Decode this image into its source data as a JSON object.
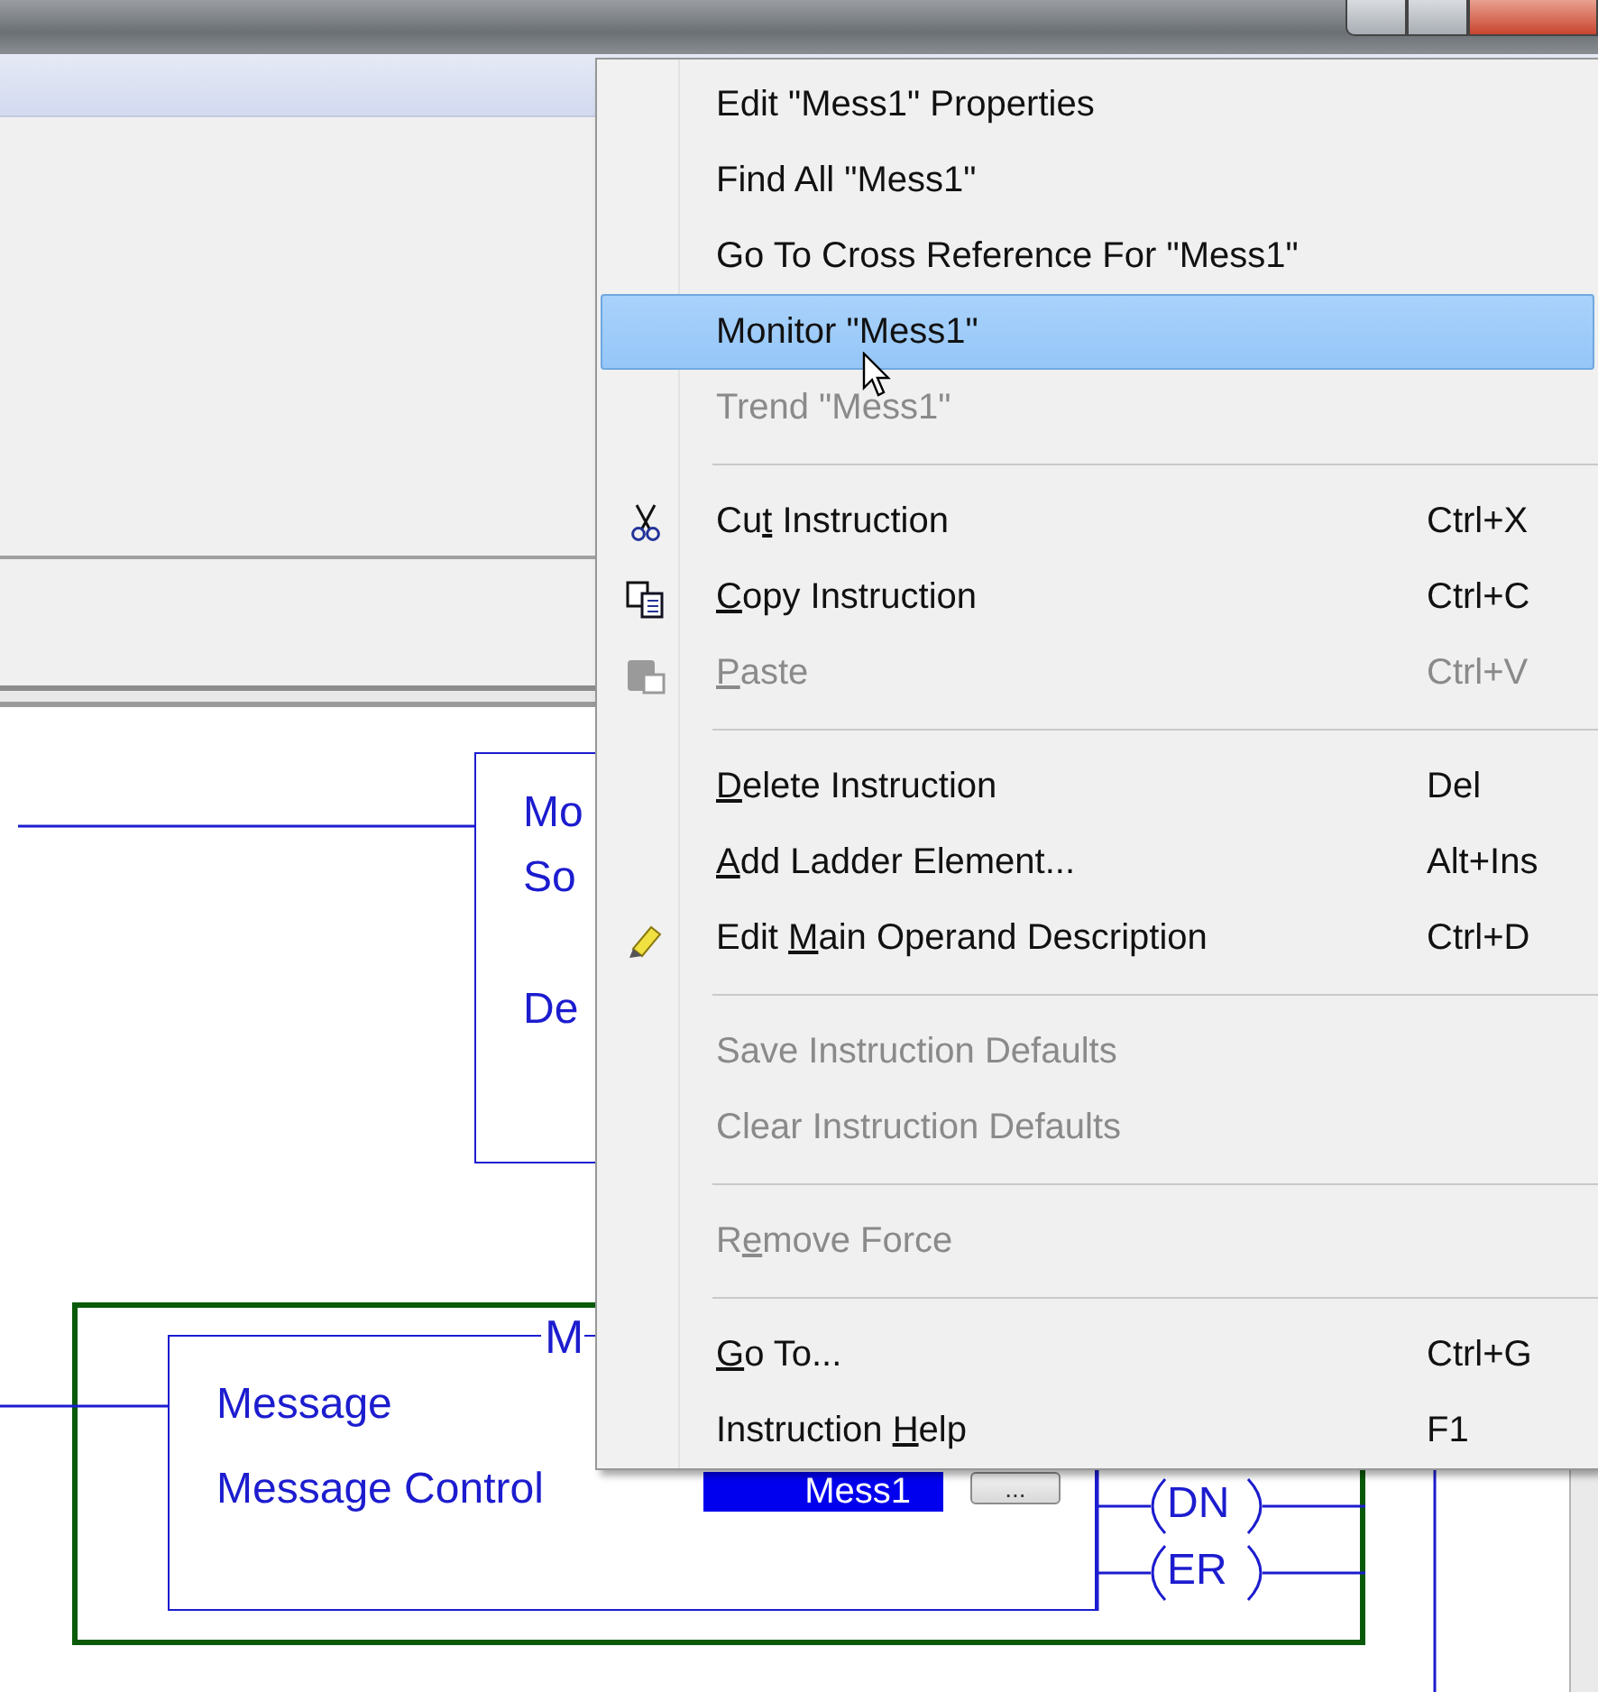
{
  "ladder": {
    "rungs": [
      {
        "kind": "block",
        "selected": false,
        "lines": [
          "Mo",
          "So",
          "De"
        ]
      },
      {
        "kind": "message",
        "selected": true,
        "header": "M",
        "lines": [
          "Message",
          "Message Control"
        ],
        "tag": "Mess1",
        "browse": "...",
        "coils": [
          "DN",
          "ER"
        ]
      }
    ]
  },
  "context_menu": {
    "items": [
      {
        "kind": "item",
        "label": "Edit \"Mess1\" Properties",
        "disabled": false,
        "selected": false
      },
      {
        "kind": "item",
        "label": "Find All \"Mess1\"",
        "disabled": false,
        "selected": false
      },
      {
        "kind": "item",
        "label": "Go To Cross Reference For \"Mess1\"",
        "disabled": false,
        "selected": false
      },
      {
        "kind": "item",
        "label": "Monitor \"Mess1\"",
        "disabled": false,
        "selected": true
      },
      {
        "kind": "item",
        "label": "Trend \"Mess1\"",
        "disabled": true,
        "selected": false
      },
      {
        "kind": "separator"
      },
      {
        "kind": "item",
        "parts": {
          "before": "Cu",
          "key": "t",
          "after": " Instruction"
        },
        "shortcut": "Ctrl+X",
        "disabled": false,
        "selected": false
      },
      {
        "kind": "item",
        "parts": {
          "key": "C",
          "after": "opy Instruction"
        },
        "shortcut": "Ctrl+C",
        "disabled": false,
        "selected": false
      },
      {
        "kind": "item",
        "parts": {
          "key": "P",
          "after": "aste"
        },
        "shortcut": "Ctrl+V",
        "disabled": true,
        "selected": false
      },
      {
        "kind": "separator"
      },
      {
        "kind": "item",
        "parts": {
          "key": "D",
          "after": "elete Instruction"
        },
        "shortcut": "Del",
        "disabled": false,
        "selected": false
      },
      {
        "kind": "item",
        "parts": {
          "key": "A",
          "after": "dd Ladder Element..."
        },
        "shortcut": "Alt+Ins",
        "disabled": false,
        "selected": false
      },
      {
        "kind": "item",
        "parts": {
          "before": "Edit ",
          "key": "M",
          "after": "ain Operand Description"
        },
        "shortcut": "Ctrl+D",
        "disabled": false,
        "selected": false
      },
      {
        "kind": "separator"
      },
      {
        "kind": "item",
        "label": "Save Instruction Defaults",
        "disabled": true,
        "selected": false
      },
      {
        "kind": "item",
        "label": "Clear Instruction Defaults",
        "disabled": true,
        "selected": false
      },
      {
        "kind": "separator"
      },
      {
        "kind": "item",
        "parts": {
          "before": "R",
          "key": "e",
          "after": "move Force"
        },
        "disabled": true,
        "selected": false
      },
      {
        "kind": "separator"
      },
      {
        "kind": "item",
        "parts": {
          "key": "G",
          "after": "o To..."
        },
        "shortcut": "Ctrl+G",
        "disabled": false,
        "selected": false
      },
      {
        "kind": "item",
        "parts": {
          "before": "Instruction ",
          "key": "H",
          "after": "elp"
        },
        "shortcut": "F1",
        "disabled": false,
        "selected": false
      }
    ]
  }
}
